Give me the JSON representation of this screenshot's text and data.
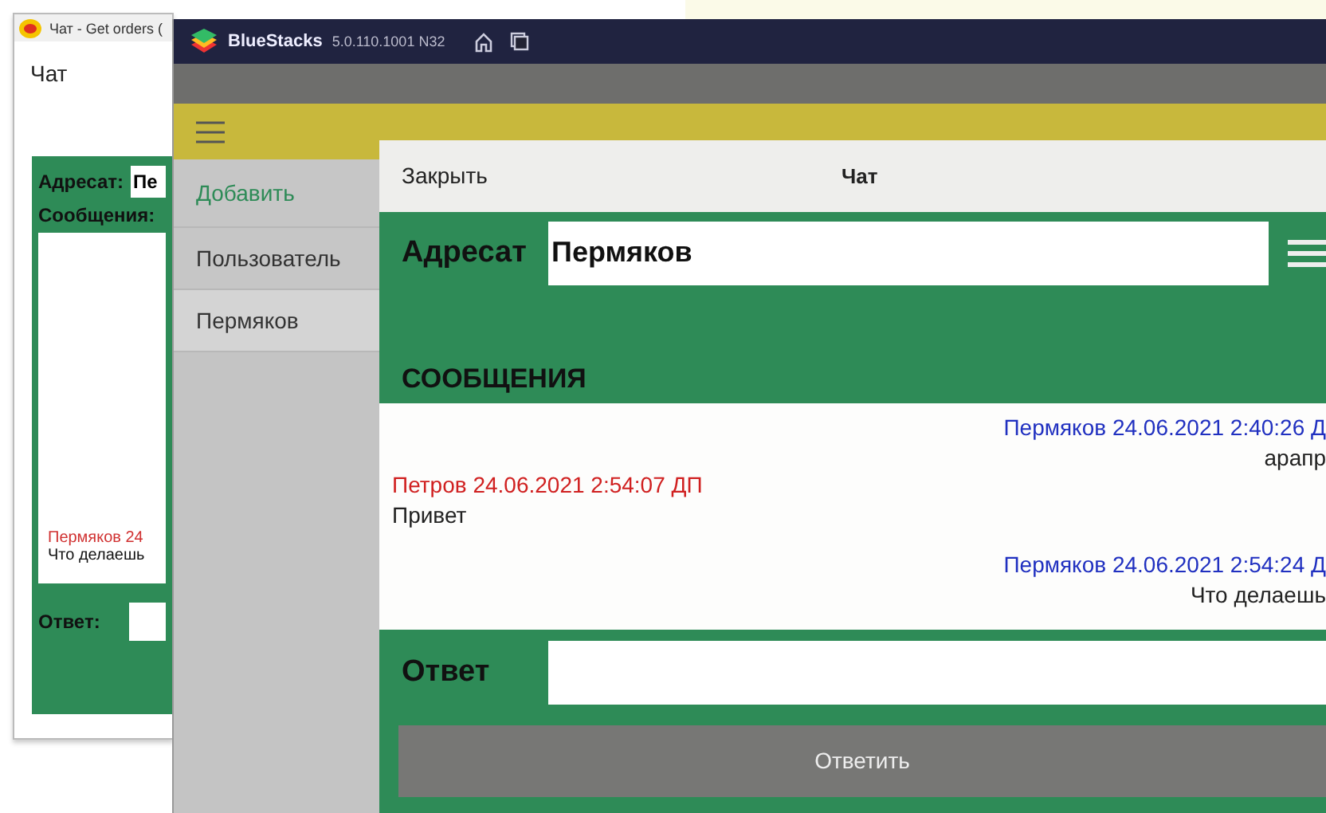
{
  "back_window": {
    "title": "Чат - Get orders (",
    "heading": "Чат",
    "recipient_label": "Адресат:",
    "recipient_value": "Пе",
    "messages_label": "Сообщения:",
    "messages": [
      {
        "author": "Пермяков 24",
        "text": "Что делаешь"
      }
    ],
    "reply_label": "Ответ:"
  },
  "emulator": {
    "title": "BlueStacks",
    "version": "5.0.110.1001 N32"
  },
  "drawer": {
    "items": [
      {
        "label": "Добавить",
        "kind": "action",
        "selected": false
      },
      {
        "label": "Пользователь",
        "kind": "item",
        "selected": false
      },
      {
        "label": "Пермяков",
        "kind": "item",
        "selected": true
      }
    ]
  },
  "dialog": {
    "close": "Закрыть",
    "title": "Чат",
    "recipient_label": "Адресат",
    "recipient_value": "Пермяков",
    "messages_heading": "СООБЩЕНИЯ",
    "messages": [
      {
        "kind": "incoming",
        "author": "Пермяков 24.06.2021 2:40:26 Д",
        "text": "арапр"
      },
      {
        "kind": "outgoing",
        "author": "Петров 24.06.2021 2:54:07 ДП",
        "text": "Привет"
      },
      {
        "kind": "incoming",
        "author": "Пермяков 24.06.2021 2:54:24 Д",
        "text": "Что делаешь"
      }
    ],
    "reply_label": "Ответ",
    "reply_button": "Ответить"
  }
}
